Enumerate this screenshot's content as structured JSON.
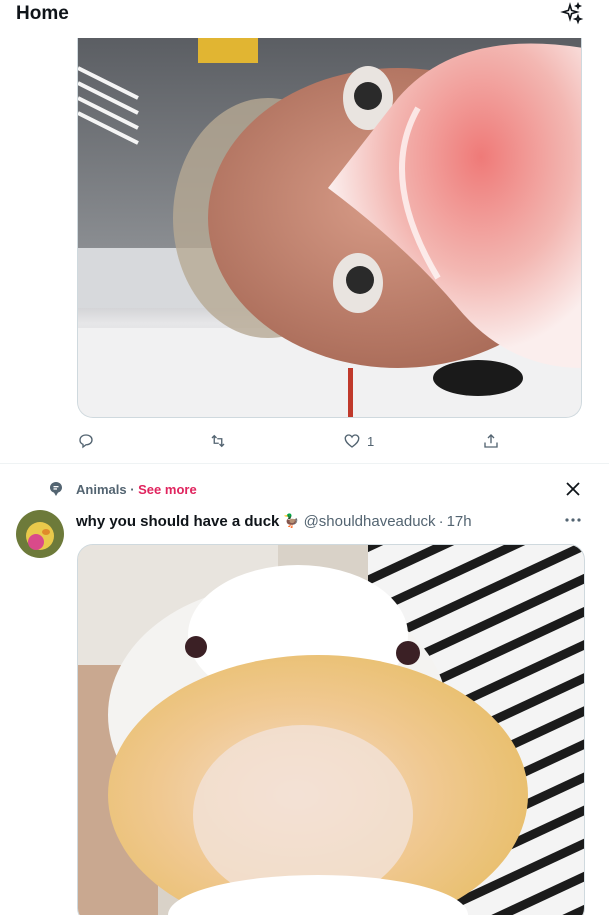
{
  "header": {
    "title": "Home",
    "sparkle_icon": "sparkle-icon"
  },
  "tweet1": {
    "media_alt": "selfie photo",
    "actions": {
      "reply": "",
      "retweet": "",
      "like": "1",
      "share": ""
    }
  },
  "topic": {
    "label": "Animals",
    "separator": " · ",
    "see_more": "See more"
  },
  "tweet2": {
    "display_name": "why you should have a duck",
    "emoji": "🦆",
    "handle": "@shouldhaveaduck",
    "time": "17h",
    "media_alt": "duck close-up photo"
  },
  "colors": {
    "accent_pink": "#e0245e",
    "text_secondary": "#536471",
    "border": "#cfd9de"
  }
}
